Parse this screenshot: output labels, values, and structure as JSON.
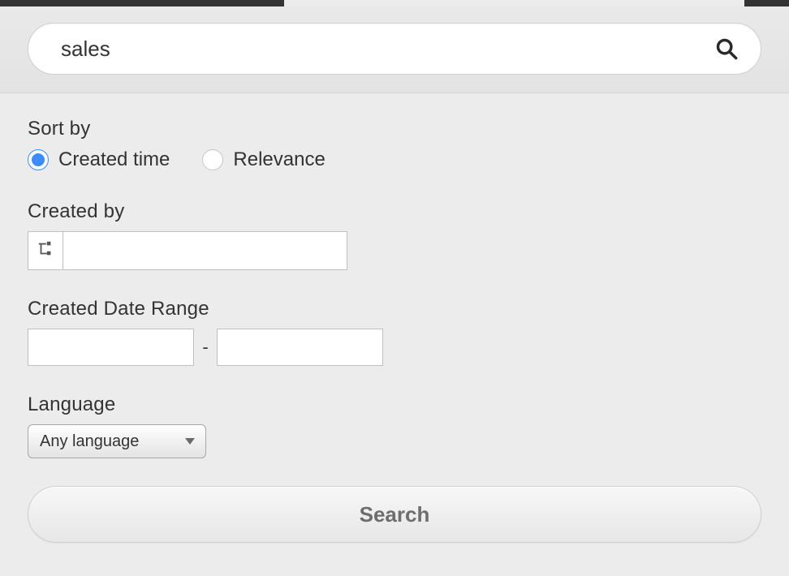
{
  "search": {
    "value": "sales",
    "icon": "search-icon"
  },
  "sort": {
    "label": "Sort by",
    "options": {
      "created_time": "Created time",
      "relevance": "Relevance"
    },
    "selected": "created_time"
  },
  "created_by": {
    "label": "Created by",
    "value": "",
    "icon": "org-tree-icon"
  },
  "date_range": {
    "label": "Created Date Range",
    "from": "",
    "to": "",
    "separator": "-"
  },
  "language": {
    "label": "Language",
    "selected": "Any language"
  },
  "search_button": {
    "label": "Search"
  }
}
